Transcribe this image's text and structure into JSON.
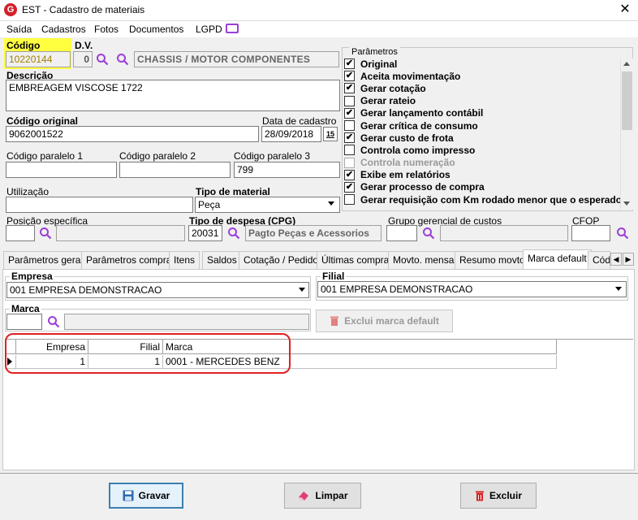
{
  "window": {
    "title": "EST - Cadastro de materiais",
    "close_label": "✕"
  },
  "menu": [
    "Saída",
    "Cadastros",
    "Fotos",
    "Documentos",
    "LGPD"
  ],
  "form": {
    "codigo_label": "Código",
    "codigo_value": "10220144",
    "dv_label": "D.V.",
    "dv_value": "0",
    "grupo_value": "CHASSIS / MOTOR COMPONENTES",
    "descricao_label": "Descrição",
    "descricao_value": "EMBREAGEM VISCOSE 1722",
    "codigo_original_label": "Código original",
    "codigo_original_value": "9062001522",
    "data_cadastro_label": "Data de cadastro",
    "data_cadastro_value": "28/09/2018",
    "calendar_label": "15",
    "cod_paralelo1_label": "Código paralelo 1",
    "cod_paralelo1_value": "",
    "cod_paralelo2_label": "Código paralelo 2",
    "cod_paralelo2_value": "",
    "cod_paralelo3_label": "Código paralelo 3",
    "cod_paralelo3_value": "799",
    "utilizacao_label": "Utilização",
    "utilizacao_value": "",
    "tipo_material_label": "Tipo de material",
    "tipo_material_value": "Peça",
    "posicao_label": "Posição específica",
    "tipo_despesa_label": "Tipo de despesa (CPG)",
    "tipo_despesa_code": "20031",
    "tipo_despesa_desc": "Pagto Peças e Acessorios",
    "grupo_gerencial_label": "Grupo gerencial de custos",
    "cfop_label": "CFOP"
  },
  "params": {
    "label": "Parâmetros",
    "items": [
      {
        "label": "Original",
        "checked": true,
        "disabled": false
      },
      {
        "label": "Aceita movimentação",
        "checked": true,
        "disabled": false
      },
      {
        "label": "Gerar cotação",
        "checked": true,
        "disabled": false
      },
      {
        "label": "Gerar rateio",
        "checked": false,
        "disabled": false
      },
      {
        "label": "Gerar lançamento contábil",
        "checked": true,
        "disabled": false
      },
      {
        "label": "Gerar crítica de consumo",
        "checked": false,
        "disabled": false
      },
      {
        "label": "Gerar custo de frota",
        "checked": true,
        "disabled": false
      },
      {
        "label": "Controla como impresso",
        "checked": false,
        "disabled": false
      },
      {
        "label": "Controla numeração",
        "checked": false,
        "disabled": true
      },
      {
        "label": "Exibe em relatórios",
        "checked": true,
        "disabled": false
      },
      {
        "label": "Gerar processo de compra",
        "checked": true,
        "disabled": false
      },
      {
        "label": "Gerar requisição com Km rodado menor que o esperado",
        "checked": false,
        "disabled": false
      }
    ]
  },
  "tabs": [
    "Parâmetros gerais",
    "Parâmetros compras",
    "Itens",
    "Saldos",
    "Cotação / Pedido",
    "Últimas compras",
    "Movto. mensal",
    "Resumo movto.",
    "Marca default",
    "Códi"
  ],
  "marca_tab": {
    "empresa_label": "Empresa",
    "empresa_value": "001 EMPRESA DEMONSTRACAO",
    "filial_label": "Filial",
    "filial_value": "001 EMPRESA DEMONSTRACAO",
    "marca_label": "Marca",
    "exclui_label": "Exclui marca default",
    "grid_headers": [
      "Empresa",
      "Filial",
      "Marca"
    ],
    "grid_rows": [
      [
        "1",
        "1",
        "0001 - MERCEDES BENZ"
      ]
    ]
  },
  "buttons": {
    "gravar": "Gravar",
    "limpar": "Limpar",
    "excluir": "Excluir"
  },
  "colors": {
    "highlight_yellow": "#ffff40",
    "annotation_red": "#e02020",
    "search_icon": "#9b3fd8",
    "delete_red": "#d82020"
  }
}
